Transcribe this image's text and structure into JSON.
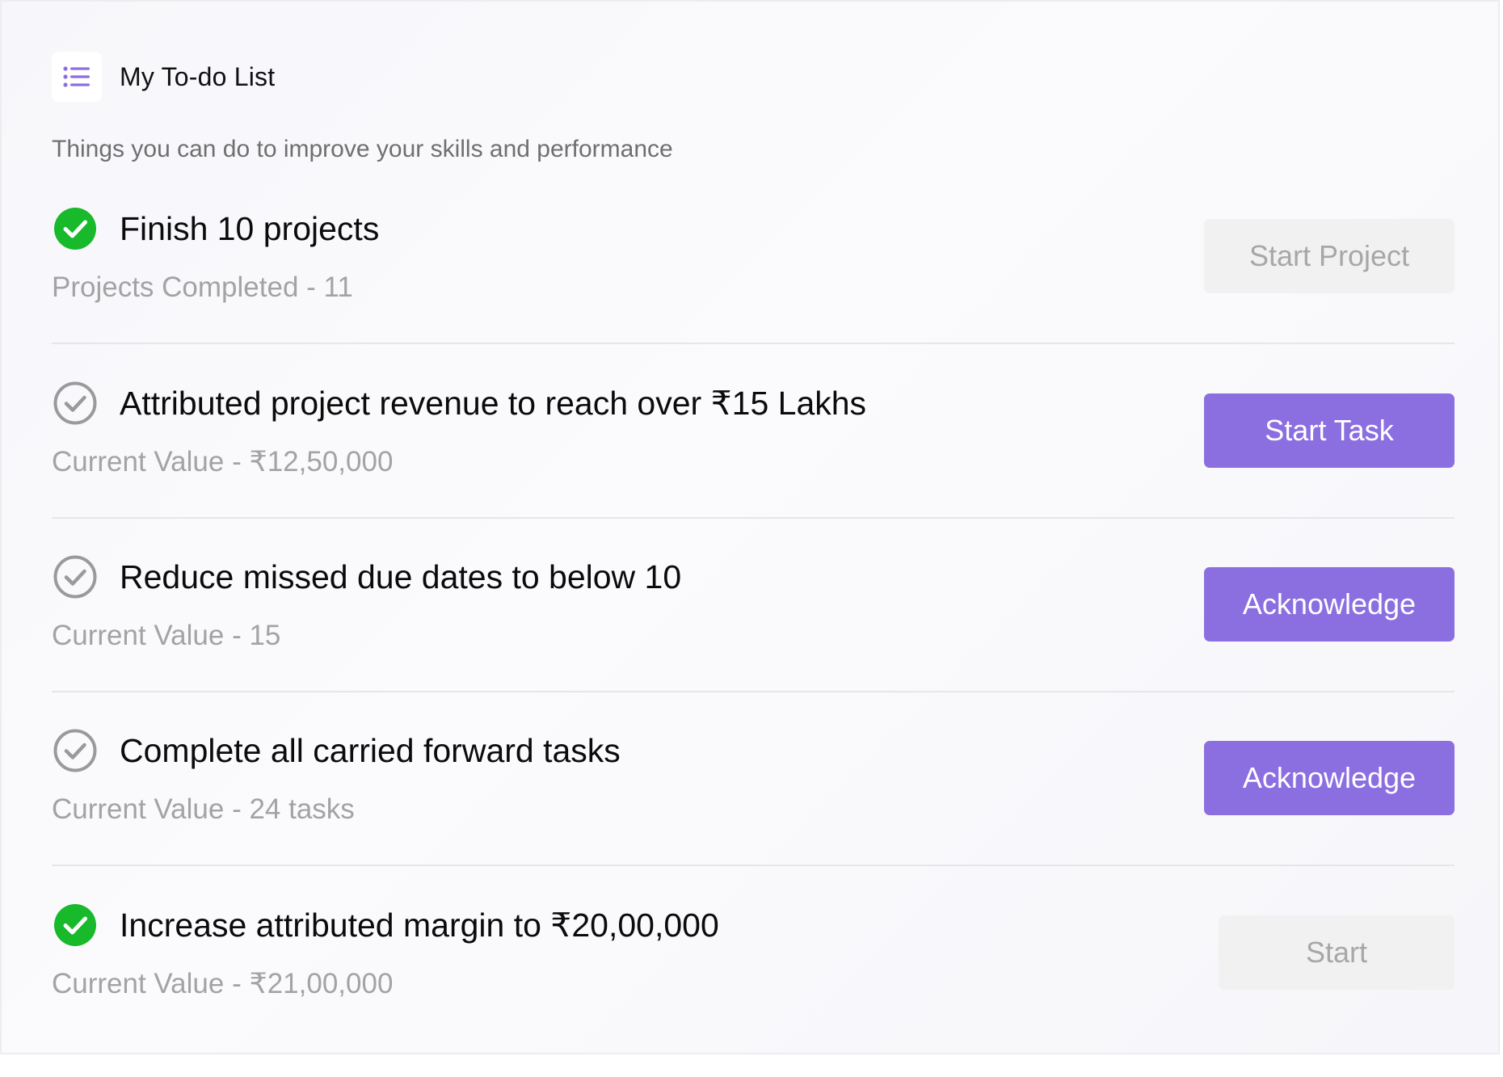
{
  "header": {
    "title": "My To-do List",
    "icon": "list-icon"
  },
  "subtitle": "Things you can do to improve your skills and performance",
  "colors": {
    "accent": "#8b6fe0",
    "done": "#18b92a",
    "pending": "#9a9a9a"
  },
  "tasks": [
    {
      "title": "Finish 10 projects",
      "detail": "Projects Completed - 11",
      "status": "done",
      "button": "Start Project",
      "button_state": "disabled"
    },
    {
      "title": "Attributed project revenue to reach over ₹15 Lakhs",
      "detail": "Current Value - ₹12,50,000",
      "status": "pending",
      "button": "Start Task",
      "button_state": "enabled"
    },
    {
      "title": "Reduce missed due dates to below 10",
      "detail": "Current Value - 15",
      "status": "pending",
      "button": "Acknowledge",
      "button_state": "enabled"
    },
    {
      "title": "Complete all carried forward tasks",
      "detail": "Current Value - 24 tasks",
      "status": "pending",
      "button": "Acknowledge",
      "button_state": "enabled"
    },
    {
      "title": "Increase attributed margin to ₹20,00,000",
      "detail": "Current Value - ₹21,00,000",
      "status": "done",
      "button": "Start",
      "button_state": "disabled"
    }
  ]
}
